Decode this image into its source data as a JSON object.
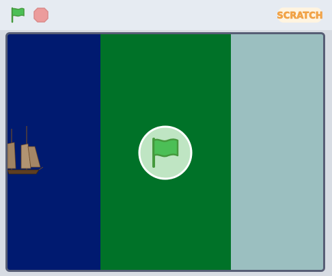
{
  "toolbar": {
    "green_flag_icon": "green-flag-icon",
    "stop_icon": "stop-sign-icon",
    "logo_text": "SCRATCH"
  },
  "stage": {
    "backdrop_colors": {
      "left": "#001a70",
      "middle": "#007228",
      "right": "#9bbfc0"
    },
    "sprite": "sailing-ship",
    "overlay_icon": "green-flag-icon"
  },
  "colors": {
    "flag_green": "#4cbf56",
    "stop_red": "#ec9c9c",
    "logo_orange": "#f7a84a",
    "stage_border": "#575e75"
  }
}
